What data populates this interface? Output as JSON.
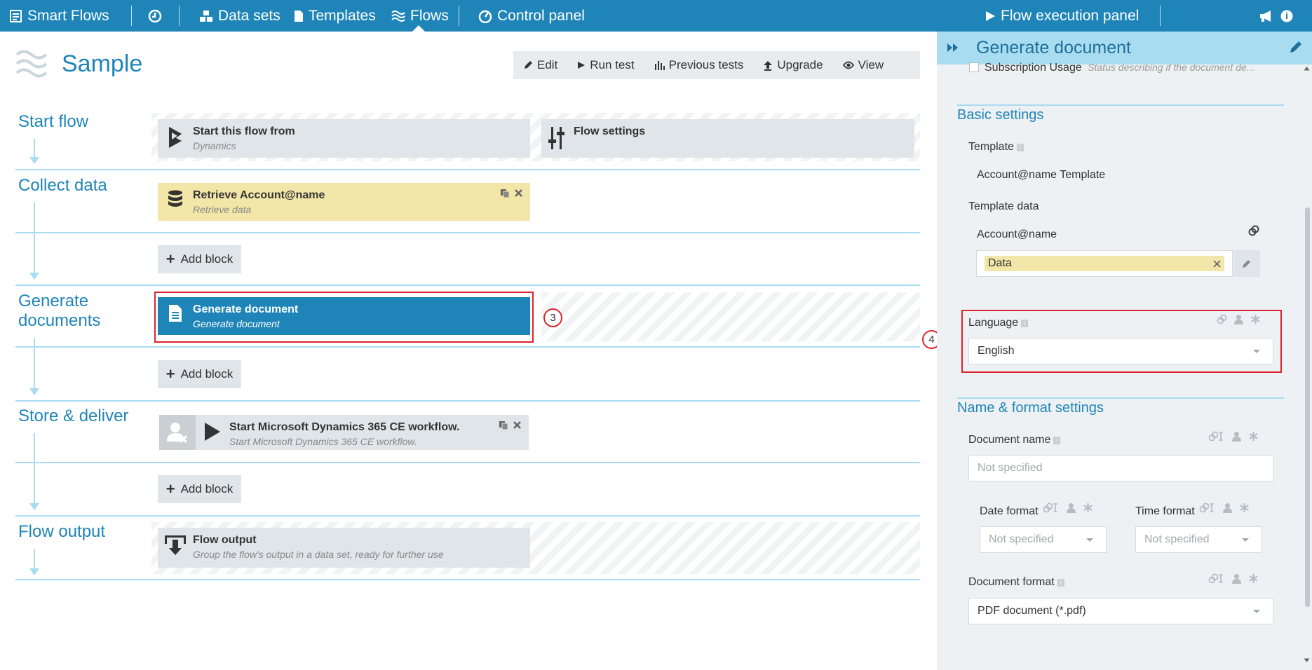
{
  "nav": {
    "brand": "Smart Flows",
    "data_sets": "Data sets",
    "templates": "Templates",
    "flows": "Flows",
    "control_panel": "Control panel",
    "execution_panel": "Flow execution panel"
  },
  "page": {
    "title": "Sample",
    "toolbar": {
      "edit": "Edit",
      "run_test": "Run test",
      "previous_tests": "Previous tests",
      "upgrade": "Upgrade",
      "view": "View"
    }
  },
  "stages": {
    "start": "Start flow",
    "collect": "Collect data",
    "generate_line1": "Generate",
    "generate_line2": "documents",
    "store": "Store & deliver",
    "output": "Flow output"
  },
  "blocks": {
    "start_from": {
      "title": "Start this flow from",
      "subtitle": "Dynamics"
    },
    "flow_settings": {
      "title": "Flow settings"
    },
    "retrieve": {
      "title": "Retrieve Account@name",
      "subtitle": "Retrieve data"
    },
    "generate": {
      "title": "Generate document",
      "subtitle": "Generate document"
    },
    "dynamics_workflow": {
      "title": "Start Microsoft Dynamics 365 CE workflow.",
      "subtitle": "Start Microsoft Dynamics 365 CE workflow."
    },
    "flow_output": {
      "title": "Flow output",
      "subtitle": "Group the flow's output in a data set, ready for further use"
    },
    "add_block": "Add block"
  },
  "markers": {
    "m3": "3",
    "m4": "4"
  },
  "panel": {
    "title": "Generate document",
    "subscription_label": "Subscription Usage",
    "subscription_desc": "Status describing if the document de...",
    "basic_settings": "Basic settings",
    "template_label": "Template",
    "template_value": "Account@name Template",
    "template_data_label": "Template data",
    "account_name": "Account@name",
    "data_tag": "Data",
    "language_label": "Language",
    "language_value": "English",
    "name_format_settings": "Name & format settings",
    "document_name_label": "Document name",
    "document_name_placeholder": "Not specified",
    "date_format_label": "Date format",
    "date_format_value": "Not specified",
    "time_format_label": "Time format",
    "time_format_value": "Not specified",
    "document_format_label": "Document format",
    "document_format_value": "PDF document (*.pdf)"
  },
  "colors": {
    "brand_blue": "#1f85b8",
    "panel_header": "#a8dcf0",
    "block_yellow": "#f2e6a8",
    "block_grey": "#dfe5e8",
    "highlight_red": "#d9252b"
  }
}
